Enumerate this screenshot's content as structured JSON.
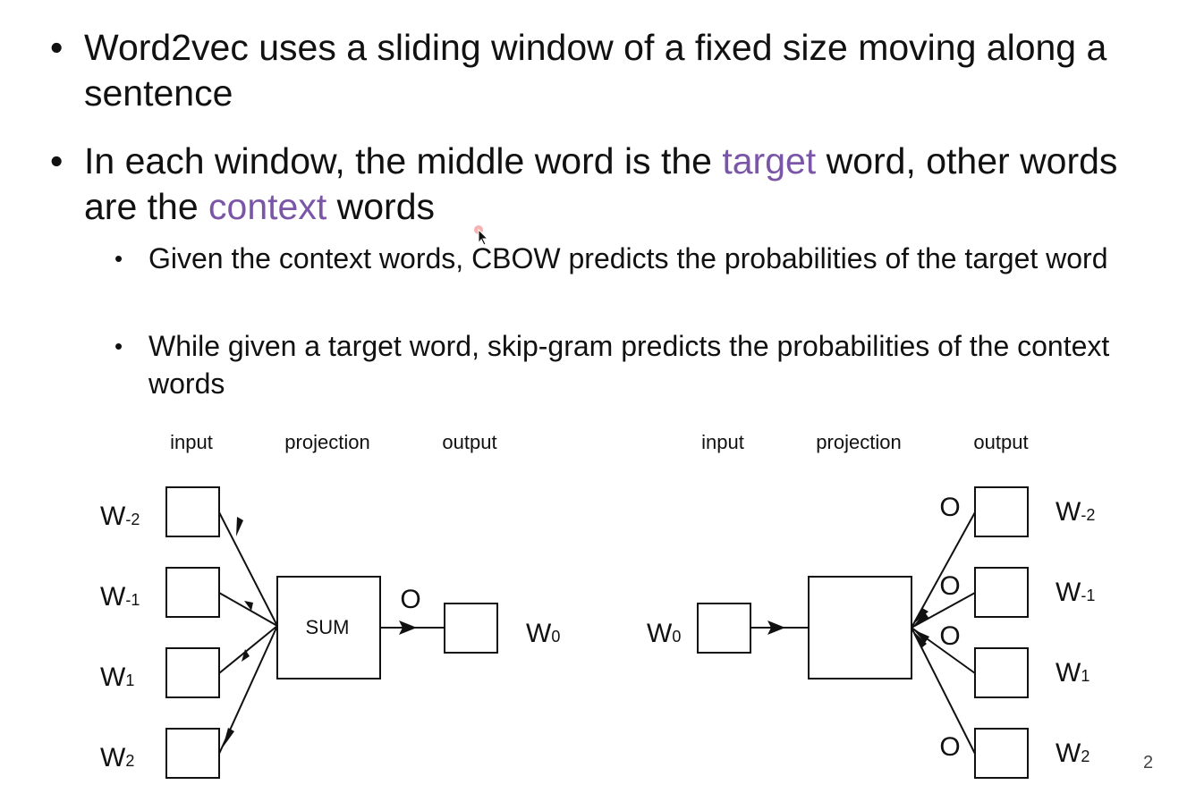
{
  "bullets": [
    {
      "text": "Word2vec uses a sliding window of a fixed size moving along a sentence"
    },
    {
      "pre": "In each window, the middle word is the ",
      "highlight1": "target",
      "mid1": " word, other words are the ",
      "highlight2": "context",
      "post": " words",
      "sub": [
        "Given the context words, CBOW predicts the probabilities of the target word",
        "While given a target word, skip-gram predicts the probabilities of the context words"
      ]
    }
  ],
  "colors": {
    "highlight": "#7b56a8"
  },
  "cbow": {
    "headers": [
      "input",
      "projection",
      "output"
    ],
    "inputs": [
      "W",
      "W",
      "W",
      "W"
    ],
    "input_subs": [
      "-2",
      "-1",
      "1",
      "2"
    ],
    "box_label": "SUM",
    "o_label": "O",
    "output_word": "W",
    "output_sub": "0"
  },
  "skipgram": {
    "headers": [
      "input",
      "projection",
      "output"
    ],
    "input_word": "W",
    "input_sub": "0",
    "o_labels": [
      "O",
      "O",
      "O",
      "O"
    ],
    "outputs": [
      "W",
      "W",
      "W",
      "W"
    ],
    "output_subs": [
      "-2",
      "-1",
      "1",
      "2"
    ]
  },
  "page_number": "2"
}
